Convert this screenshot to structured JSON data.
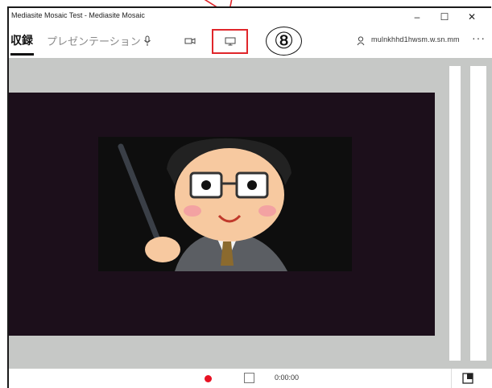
{
  "window": {
    "title": "Mediasite Mosaic Test - Mediasite Mosaic",
    "controls": {
      "minimize": "–",
      "maximize": "☐",
      "close": "✕"
    }
  },
  "toolbar": {
    "tabs": [
      {
        "label": "収録",
        "selected": true
      },
      {
        "label": "プレゼンテーション",
        "selected": false
      }
    ],
    "icons": [
      "microphone-icon",
      "camera-icon",
      "screen-icon"
    ],
    "annotation_number": "⑧",
    "user": {
      "name": "mulnkhhd1hwsm.w.sn.mm"
    },
    "more_label": "···"
  },
  "bottom_bar": {
    "timer": "0:00:00"
  },
  "colors": {
    "highlight": "#e0262b",
    "record": "#e81123",
    "stage_bg": "#c6c8c6",
    "video_bg": "#1c0f1b"
  }
}
